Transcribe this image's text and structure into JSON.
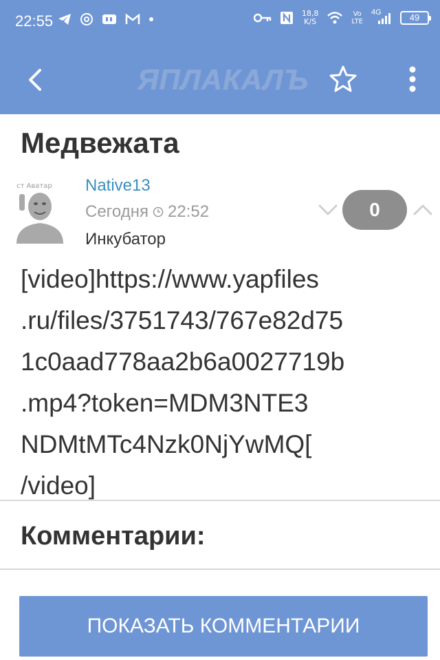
{
  "status_bar": {
    "time": "22:55",
    "left_icons": [
      "telegram-icon",
      "at-icon",
      "vk-icon",
      "gmail-icon",
      "dot-icon"
    ],
    "speed_value": "18,8",
    "speed_unit": "K/S",
    "volte_top": "Vo",
    "volte_bottom": "LTE",
    "network": "4G",
    "battery": "49"
  },
  "app_bar": {
    "logo": "ЯПЛАКАЛЪ"
  },
  "post": {
    "title": "Медвежата",
    "author": "Native13",
    "date": "Сегодня",
    "time": "22:52",
    "section": "Инкубатор",
    "rating": "0",
    "body_lines": [
      "[video]https://www.yapfiles",
      ".ru/files/3751743/767e82d75",
      "1c0aad778aa2b6a0027719b",
      ".mp4?token=MDM3NTE3",
      "NDMtMTc4Nzk0NjYwMQ[",
      "/video]"
    ]
  },
  "comments": {
    "heading": "Комментарии:",
    "show_button": "ПОКАЗАТЬ КОММЕНТАРИИ"
  },
  "colors": {
    "primary": "#6e95d4",
    "author_link": "#3a8fc1",
    "muted": "#9b9b9b",
    "text": "#333333",
    "rating_badge": "#8e8e8e"
  }
}
